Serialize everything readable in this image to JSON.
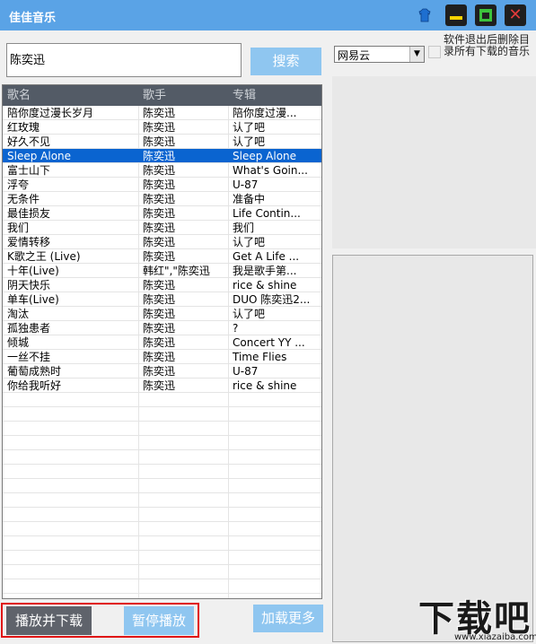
{
  "app": {
    "title": "佳佳音乐"
  },
  "search": {
    "value": "陈奕迅",
    "button_label": "搜索"
  },
  "source": {
    "selected": "网易云"
  },
  "options": {
    "delete_on_exit_label": "软件退出后删除目录所有下载的音乐"
  },
  "table": {
    "headers": [
      "歌名",
      "歌手",
      "专辑"
    ],
    "rows": [
      [
        "陪你度过漫长岁月",
        "陈奕迅",
        "陪你度过漫..."
      ],
      [
        "红玫瑰",
        "陈奕迅",
        "认了吧"
      ],
      [
        "好久不见",
        "陈奕迅",
        "认了吧"
      ],
      [
        "Sleep Alone",
        "陈奕迅",
        "Sleep Alone"
      ],
      [
        "富士山下",
        "陈奕迅",
        "What's Goin..."
      ],
      [
        "浮夸",
        "陈奕迅",
        "U-87"
      ],
      [
        "无条件",
        "陈奕迅",
        "准备中"
      ],
      [
        "最佳损友",
        "陈奕迅",
        "Life Contin..."
      ],
      [
        "我们",
        "陈奕迅",
        "我们"
      ],
      [
        "爱情转移",
        "陈奕迅",
        "认了吧"
      ],
      [
        "K歌之王 (Live)",
        "陈奕迅",
        "Get A Life ..."
      ],
      [
        "十年(Live)",
        "韩红\",\"陈奕迅",
        "我是歌手第..."
      ],
      [
        "阴天快乐",
        "陈奕迅",
        "rice & shine"
      ],
      [
        "单车(Live)",
        "陈奕迅",
        "DUO 陈奕迅2..."
      ],
      [
        "淘汰",
        "陈奕迅",
        "认了吧"
      ],
      [
        "孤独患者",
        "陈奕迅",
        "?"
      ],
      [
        "倾城",
        "陈奕迅",
        "Concert YY ..."
      ],
      [
        "一丝不挂",
        "陈奕迅",
        "Time Flies"
      ],
      [
        "葡萄成熟时",
        "陈奕迅",
        "U-87"
      ],
      [
        "你给我听好",
        "陈奕迅",
        "rice & shine"
      ]
    ],
    "selected_index": 3
  },
  "buttons": {
    "play_download": "播放并下载",
    "pause": "暂停播放",
    "load_more": "加载更多"
  },
  "watermark": {
    "text": "下载吧",
    "url": "www.xiazaiba.com"
  },
  "colors": {
    "titlebar": "#5aa3e6",
    "accent_button": "#8fc6f0",
    "selection": "#0a64d0",
    "highlight": "#e01414"
  }
}
